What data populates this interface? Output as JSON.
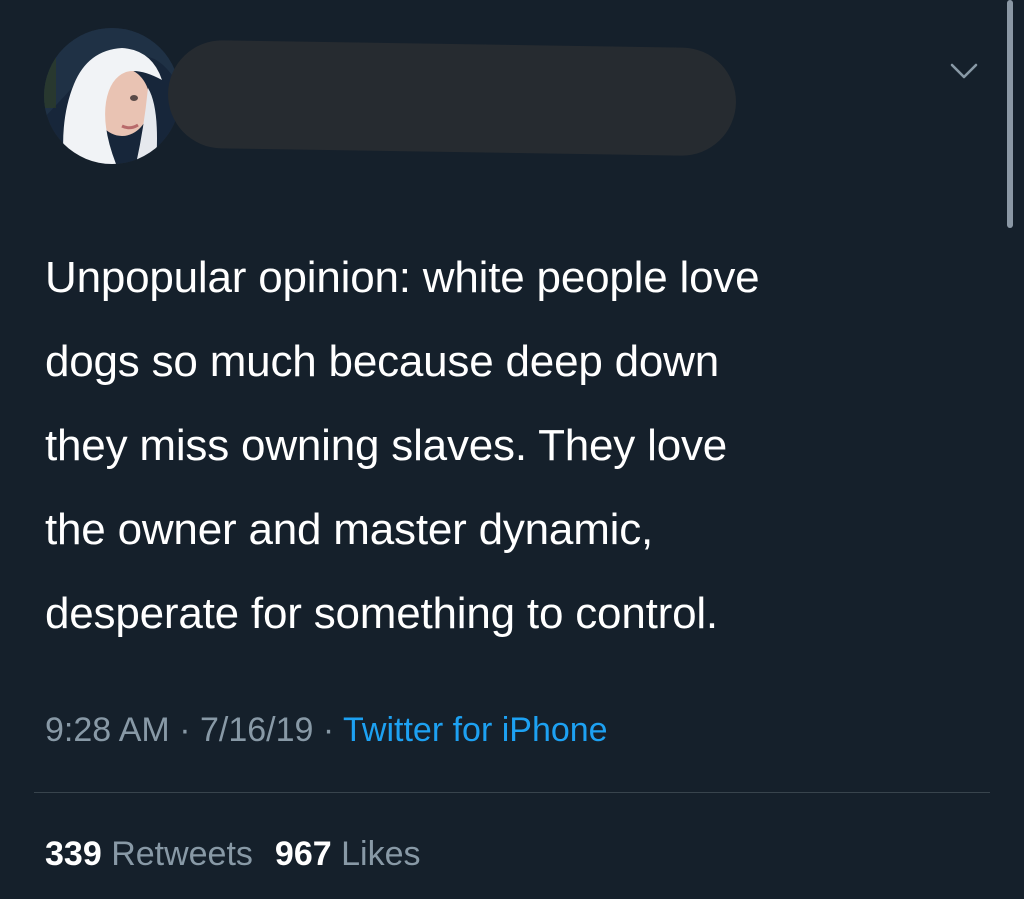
{
  "tweet": {
    "avatar": {
      "icon": "profile-photo-avatar",
      "description_colors": {
        "hair": "#f1f3f6",
        "hood": "#1c2b3d",
        "skin": "#e9c3b3"
      }
    },
    "author_name_redacted": true,
    "menu_icon": "chevron-down-icon",
    "text_lines": [
      "Unpopular opinion: white people love",
      "dogs so much because deep down",
      "they miss owning slaves. They love",
      "the owner and master dynamic,",
      "desperate for something to control."
    ],
    "meta": {
      "time": "9:28 AM",
      "separator": " · ",
      "date": "7/16/19",
      "source": "Twitter for iPhone"
    },
    "stats": {
      "retweets_count": "339",
      "retweets_label": "Retweets",
      "likes_count": "967",
      "likes_label": "Likes"
    }
  },
  "colors": {
    "background": "#15202b",
    "text_primary": "#ffffff",
    "text_secondary": "#8899a6",
    "link": "#1da1f2",
    "divider": "#38444d"
  }
}
